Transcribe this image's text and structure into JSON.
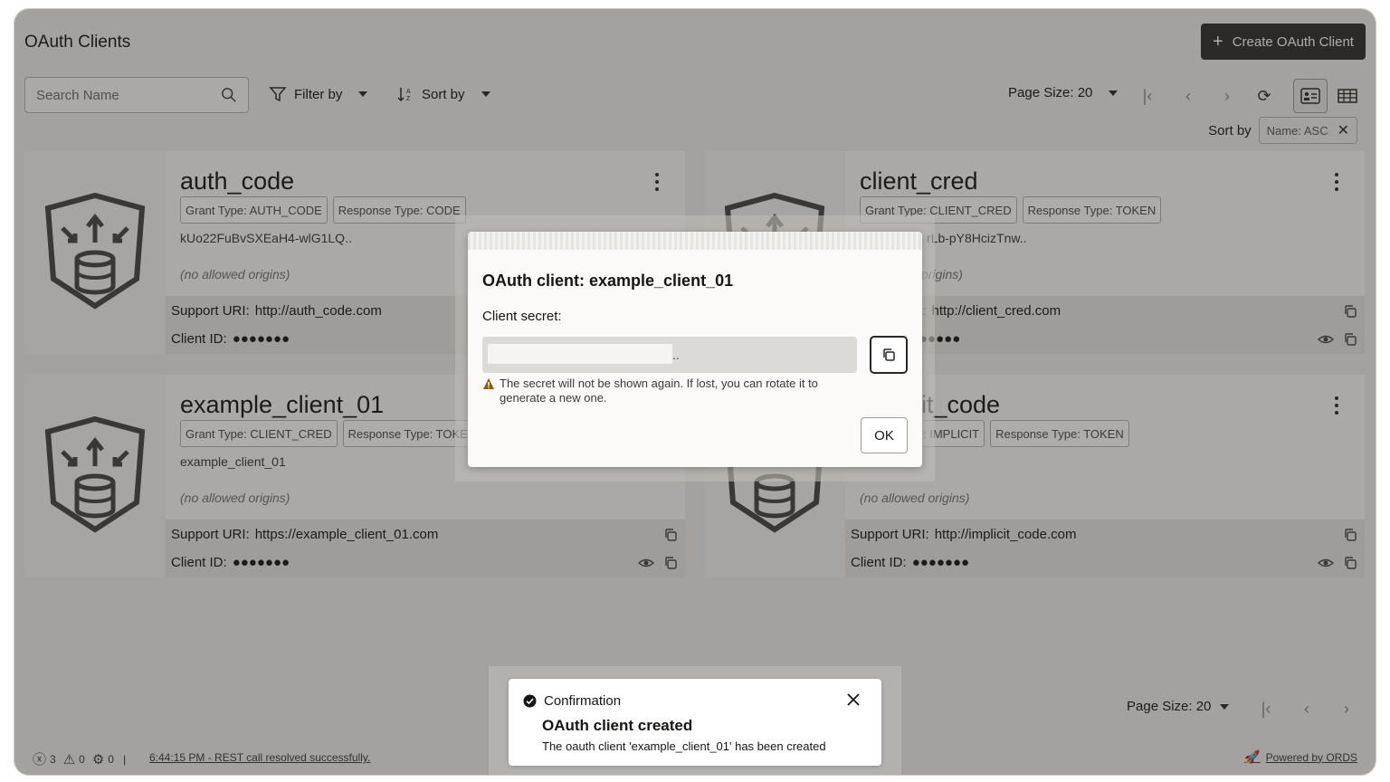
{
  "header": {
    "title": "OAuth Clients",
    "create_label": "Create OAuth Client"
  },
  "toolbar": {
    "search_placeholder": "Search Name",
    "filter_label": "Filter by",
    "sort_label": "Sort by",
    "page_size": "Page Size: 20"
  },
  "active_sort": {
    "label": "Sort by",
    "chip": "Name: ASC"
  },
  "cards": [
    {
      "name": "auth_code",
      "grant": "Grant Type: AUTH_CODE",
      "response": "Response Type: CODE",
      "secret_id": "kUo22FuBvSXEaH4-wlG1LQ..",
      "origins": "(no allowed origins)",
      "support_label": "Support URI:",
      "support": "http://auth_code.com",
      "client_id_label": "Client ID:",
      "client_id": "●●●●●●●"
    },
    {
      "name": "client_cred",
      "grant": "Grant Type: CLIENT_CRED",
      "response": "Response Type: TOKEN",
      "secret_id": "rLb-pY8HcizTnw..",
      "origins": "origins)",
      "support_label": "l:",
      "support": "http://client_cred.com",
      "client_id_label": "",
      "client_id": "●●●●●"
    },
    {
      "name": "example_client_01",
      "grant": "Grant Type: CLIENT_CRED",
      "response": "Response Type: TOKEN",
      "secret_id": "example_client_01",
      "origins": "(no allowed origins)",
      "support_label": "Support URI:",
      "support": "https://example_client_01.com",
      "client_id_label": "Client ID:",
      "client_id": "●●●●●●●"
    },
    {
      "name": "it_code",
      "grant": ": IMPLICIT",
      "response": "Response Type: TOKEN",
      "secret_id": "",
      "origins": "(no allowed origins)",
      "support_label": "Support URI:",
      "support": "http://implicit_code.com",
      "client_id_label": "Client ID:",
      "client_id": "●●●●●●●"
    }
  ],
  "dialog": {
    "title": "OAuth client: example_client_01",
    "secret_label": "Client secret:",
    "secret_suffix": "..",
    "warning": "The secret will not be shown again. If lost, you can rotate it to generate a new one.",
    "ok_label": "OK"
  },
  "bottom_pager": {
    "page_size": "Page Size: 20"
  },
  "toast": {
    "header": "Confirmation",
    "title": "OAuth client created",
    "message": "The oauth client 'example_client_01' has been created"
  },
  "status": {
    "errors": "3",
    "warnings": "0",
    "settings": "0",
    "separator": "|",
    "message": "6:44:15 PM - REST call resolved successfully.",
    "powered": "Powered by ORDS"
  },
  "colors": {
    "primary_button": "#2f2c2a",
    "background": "#f1efed",
    "card": "#fbfaf9",
    "warning": "#8a5a14"
  }
}
